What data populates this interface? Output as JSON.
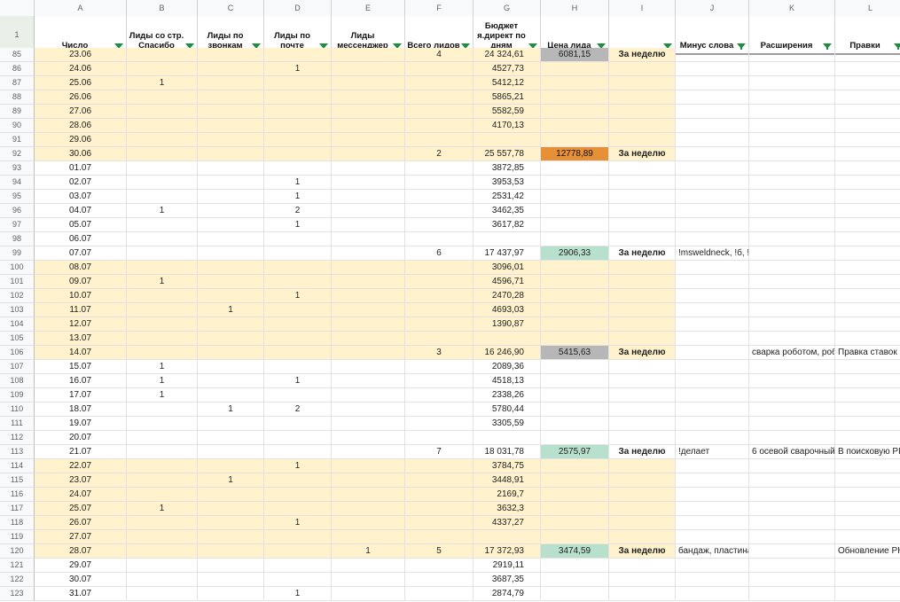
{
  "columns": [
    "A",
    "B",
    "C",
    "D",
    "E",
    "F",
    "G",
    "H",
    "I",
    "J",
    "K",
    "L"
  ],
  "header": {
    "row_num": "1",
    "cells": [
      "Число",
      "Лиды со стр. Спасибо",
      "Лиды по звонкам",
      "Лиды по почте",
      "Лиды мессенджер",
      "Всего лидов",
      "Бюджет я.директ по дням",
      "Цена лида",
      "",
      "Минус слова",
      "Расширения",
      "Правки"
    ]
  },
  "colors": {
    "tint": "#fff2cc",
    "grey": "#b7b7b7",
    "orange": "#e69138",
    "green": "#b7e1cd",
    "filter": "#1e8e3e"
  },
  "rows": [
    {
      "n": "85",
      "A": "23.06",
      "B": "",
      "C": "",
      "D": "",
      "E": "",
      "F": "4",
      "G": "24 324,61",
      "H": "6081,15",
      "I": "За неделю",
      "J": "",
      "K": "",
      "L": "",
      "tint": true,
      "hc": "grey",
      "partial": true
    },
    {
      "n": "86",
      "A": "24.06",
      "B": "",
      "C": "",
      "D": "1",
      "E": "",
      "F": "",
      "G": "4527,73",
      "H": "",
      "I": "",
      "J": "",
      "K": "",
      "L": "",
      "tint": true
    },
    {
      "n": "87",
      "A": "25.06",
      "B": "1",
      "C": "",
      "D": "",
      "E": "",
      "F": "",
      "G": "5412,12",
      "H": "",
      "I": "",
      "J": "",
      "K": "",
      "L": "",
      "tint": true
    },
    {
      "n": "88",
      "A": "26.06",
      "B": "",
      "C": "",
      "D": "",
      "E": "",
      "F": "",
      "G": "5865,21",
      "H": "",
      "I": "",
      "J": "",
      "K": "",
      "L": "",
      "tint": true
    },
    {
      "n": "89",
      "A": "27.06",
      "B": "",
      "C": "",
      "D": "",
      "E": "",
      "F": "",
      "G": "5582,59",
      "H": "",
      "I": "",
      "J": "",
      "K": "",
      "L": "",
      "tint": true
    },
    {
      "n": "90",
      "A": "28.06",
      "B": "",
      "C": "",
      "D": "",
      "E": "",
      "F": "",
      "G": "4170,13",
      "H": "",
      "I": "",
      "J": "",
      "K": "",
      "L": "",
      "tint": true
    },
    {
      "n": "91",
      "A": "29.06",
      "B": "",
      "C": "",
      "D": "",
      "E": "",
      "F": "",
      "G": "",
      "H": "",
      "I": "",
      "J": "",
      "K": "",
      "L": "",
      "tint": true
    },
    {
      "n": "92",
      "A": "30.06",
      "B": "",
      "C": "",
      "D": "",
      "E": "",
      "F": "2",
      "G": "25 557,78",
      "H": "12778,89",
      "I": "За неделю",
      "J": "",
      "K": "",
      "L": "",
      "tint": true,
      "hc": "orange"
    },
    {
      "n": "93",
      "A": "01.07",
      "B": "",
      "C": "",
      "D": "",
      "E": "",
      "F": "",
      "G": "3872,85",
      "H": "",
      "I": "",
      "J": "",
      "K": "",
      "L": ""
    },
    {
      "n": "94",
      "A": "02.07",
      "B": "",
      "C": "",
      "D": "1",
      "E": "",
      "F": "",
      "G": "3953,53",
      "H": "",
      "I": "",
      "J": "",
      "K": "",
      "L": ""
    },
    {
      "n": "95",
      "A": "03.07",
      "B": "",
      "C": "",
      "D": "1",
      "E": "",
      "F": "",
      "G": "2531,42",
      "H": "",
      "I": "",
      "J": "",
      "K": "",
      "L": ""
    },
    {
      "n": "96",
      "A": "04.07",
      "B": "1",
      "C": "",
      "D": "2",
      "E": "",
      "F": "",
      "G": "3462,35",
      "H": "",
      "I": "",
      "J": "",
      "K": "",
      "L": ""
    },
    {
      "n": "97",
      "A": "05.07",
      "B": "",
      "C": "",
      "D": "1",
      "E": "",
      "F": "",
      "G": "3617,82",
      "H": "",
      "I": "",
      "J": "",
      "K": "",
      "L": ""
    },
    {
      "n": "98",
      "A": "06.07",
      "B": "",
      "C": "",
      "D": "",
      "E": "",
      "F": "",
      "G": "",
      "H": "",
      "I": "",
      "J": "",
      "K": "",
      "L": ""
    },
    {
      "n": "99",
      "A": "07.07",
      "B": "",
      "C": "",
      "D": "",
      "E": "",
      "F": "6",
      "G": "17 437,97",
      "H": "2906,33",
      "I": "За неделю",
      "J": "!msweldneck, !б, !",
      "K": "",
      "L": "",
      "hc": "green"
    },
    {
      "n": "100",
      "A": "08.07",
      "B": "",
      "C": "",
      "D": "",
      "E": "",
      "F": "",
      "G": "3096,01",
      "H": "",
      "I": "",
      "J": "",
      "K": "",
      "L": "",
      "tint": true
    },
    {
      "n": "101",
      "A": "09.07",
      "B": "1",
      "C": "",
      "D": "",
      "E": "",
      "F": "",
      "G": "4596,71",
      "H": "",
      "I": "",
      "J": "",
      "K": "",
      "L": "",
      "tint": true
    },
    {
      "n": "102",
      "A": "10.07",
      "B": "",
      "C": "",
      "D": "1",
      "E": "",
      "F": "",
      "G": "2470,28",
      "H": "",
      "I": "",
      "J": "",
      "K": "",
      "L": "",
      "tint": true
    },
    {
      "n": "103",
      "A": "11.07",
      "B": "",
      "C": "1",
      "D": "",
      "E": "",
      "F": "",
      "G": "4693,03",
      "H": "",
      "I": "",
      "J": "",
      "K": "",
      "L": "",
      "tint": true
    },
    {
      "n": "104",
      "A": "12.07",
      "B": "",
      "C": "",
      "D": "",
      "E": "",
      "F": "",
      "G": "1390,87",
      "H": "",
      "I": "",
      "J": "",
      "K": "",
      "L": "",
      "tint": true
    },
    {
      "n": "105",
      "A": "13.07",
      "B": "",
      "C": "",
      "D": "",
      "E": "",
      "F": "",
      "G": "",
      "H": "",
      "I": "",
      "J": "",
      "K": "",
      "L": "",
      "tint": true
    },
    {
      "n": "106",
      "A": "14.07",
      "B": "",
      "C": "",
      "D": "",
      "E": "",
      "F": "3",
      "G": "16 246,90",
      "H": "5415,63",
      "I": "За неделю",
      "J": "",
      "K": "сварка роботом, роб",
      "L": "Правка ставок в",
      "tint": true,
      "hc": "grey"
    },
    {
      "n": "107",
      "A": "15.07",
      "B": "1",
      "C": "",
      "D": "",
      "E": "",
      "F": "",
      "G": "2089,36",
      "H": "",
      "I": "",
      "J": "",
      "K": "",
      "L": ""
    },
    {
      "n": "108",
      "A": "16.07",
      "B": "1",
      "C": "",
      "D": "1",
      "E": "",
      "F": "",
      "G": "4518,13",
      "H": "",
      "I": "",
      "J": "",
      "K": "",
      "L": ""
    },
    {
      "n": "109",
      "A": "17.07",
      "B": "1",
      "C": "",
      "D": "",
      "E": "",
      "F": "",
      "G": "2338,26",
      "H": "",
      "I": "",
      "J": "",
      "K": "",
      "L": ""
    },
    {
      "n": "110",
      "A": "18.07",
      "B": "",
      "C": "1",
      "D": "2",
      "E": "",
      "F": "",
      "G": "5780,44",
      "H": "",
      "I": "",
      "J": "",
      "K": "",
      "L": ""
    },
    {
      "n": "111",
      "A": "19.07",
      "B": "",
      "C": "",
      "D": "",
      "E": "",
      "F": "",
      "G": "3305,59",
      "H": "",
      "I": "",
      "J": "",
      "K": "",
      "L": ""
    },
    {
      "n": "112",
      "A": "20.07",
      "B": "",
      "C": "",
      "D": "",
      "E": "",
      "F": "",
      "G": "",
      "H": "",
      "I": "",
      "J": "",
      "K": "",
      "L": ""
    },
    {
      "n": "113",
      "A": "21.07",
      "B": "",
      "C": "",
      "D": "",
      "E": "",
      "F": "7",
      "G": "18 031,78",
      "H": "2575,97",
      "I": "За неделю",
      "J": "!делает",
      "K": "6 осевой сварочный",
      "L": "В поисковую РК",
      "hc": "green"
    },
    {
      "n": "114",
      "A": "22.07",
      "B": "",
      "C": "",
      "D": "1",
      "E": "",
      "F": "",
      "G": "3784,75",
      "H": "",
      "I": "",
      "J": "",
      "K": "",
      "L": "",
      "tint": true
    },
    {
      "n": "115",
      "A": "23.07",
      "B": "",
      "C": "1",
      "D": "",
      "E": "",
      "F": "",
      "G": "3448,91",
      "H": "",
      "I": "",
      "J": "",
      "K": "",
      "L": "",
      "tint": true
    },
    {
      "n": "116",
      "A": "24.07",
      "B": "",
      "C": "",
      "D": "",
      "E": "",
      "F": "",
      "G": "2169,7",
      "H": "",
      "I": "",
      "J": "",
      "K": "",
      "L": "",
      "tint": true
    },
    {
      "n": "117",
      "A": "25.07",
      "B": "1",
      "C": "",
      "D": "",
      "E": "",
      "F": "",
      "G": "3632,3",
      "H": "",
      "I": "",
      "J": "",
      "K": "",
      "L": "",
      "tint": true
    },
    {
      "n": "118",
      "A": "26.07",
      "B": "",
      "C": "",
      "D": "1",
      "E": "",
      "F": "",
      "G": "4337,27",
      "H": "",
      "I": "",
      "J": "",
      "K": "",
      "L": "",
      "tint": true
    },
    {
      "n": "119",
      "A": "27.07",
      "B": "",
      "C": "",
      "D": "",
      "E": "",
      "F": "",
      "G": "",
      "H": "",
      "I": "",
      "J": "",
      "K": "",
      "L": "",
      "tint": true
    },
    {
      "n": "120",
      "A": "28.07",
      "B": "",
      "C": "",
      "D": "",
      "E": "1",
      "F": "5",
      "G": "17 372,93",
      "H": "3474,59",
      "I": "За неделю",
      "J": "бандаж, пластина",
      "K": "",
      "L": "Обновление РК",
      "tint": true,
      "hc": "green"
    },
    {
      "n": "121",
      "A": "29.07",
      "B": "",
      "C": "",
      "D": "",
      "E": "",
      "F": "",
      "G": "2919,11",
      "H": "",
      "I": "",
      "J": "",
      "K": "",
      "L": ""
    },
    {
      "n": "122",
      "A": "30.07",
      "B": "",
      "C": "",
      "D": "",
      "E": "",
      "F": "",
      "G": "3687,35",
      "H": "",
      "I": "",
      "J": "",
      "K": "",
      "L": ""
    },
    {
      "n": "123",
      "A": "31.07",
      "B": "",
      "C": "",
      "D": "1",
      "E": "",
      "F": "",
      "G": "2874,79",
      "H": "",
      "I": "",
      "J": "",
      "K": "",
      "L": ""
    }
  ]
}
